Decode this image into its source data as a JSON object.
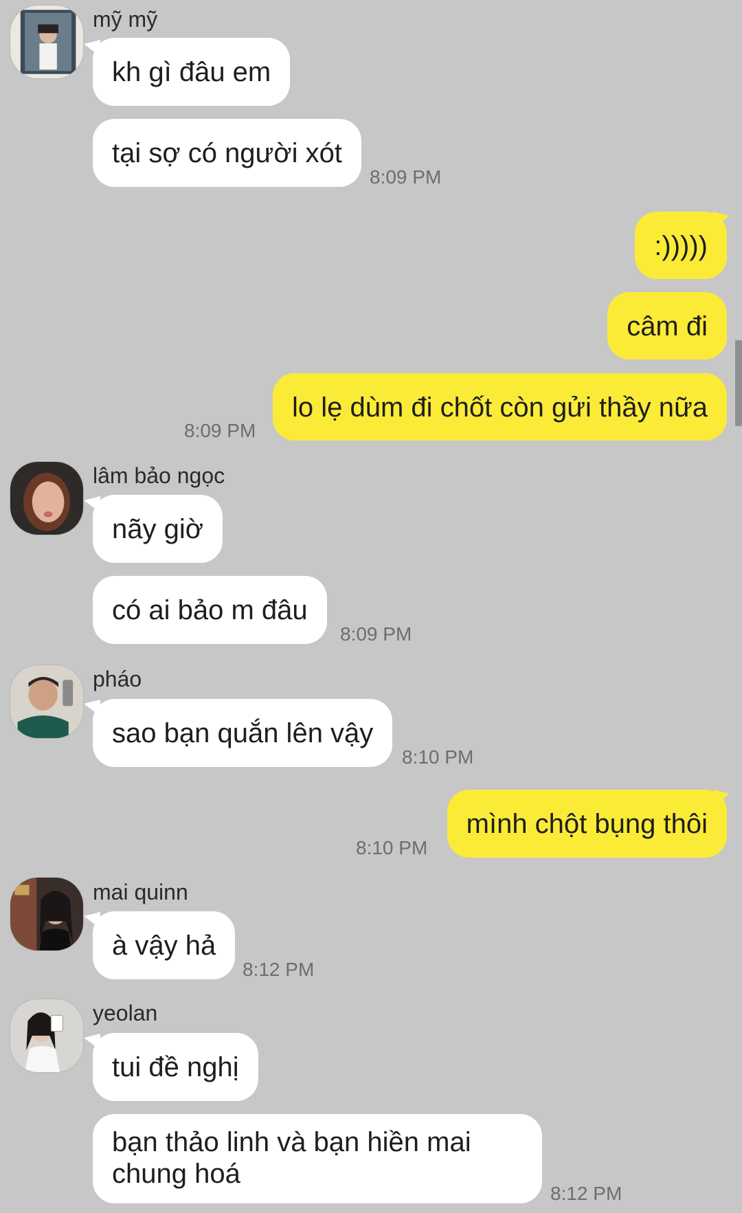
{
  "messages": [
    {
      "sender": "mỹ mỹ",
      "avatar": "avatar-my-my",
      "lines": [
        "kh gì đâu em",
        "tại sợ có người xót"
      ],
      "time": "8:09 PM"
    },
    {
      "outgoing": true,
      "lines": [
        ":)))))",
        "câm đi",
        "lo lẹ dùm đi chốt còn gửi thầy nữa"
      ],
      "time": "8:09 PM"
    },
    {
      "sender": "lâm bảo ngọc",
      "avatar": "avatar-lam-bao-ngoc",
      "lines": [
        "nãy giờ",
        "có ai bảo m đâu"
      ],
      "time": "8:09 PM"
    },
    {
      "sender": "pháo",
      "avatar": "avatar-phao",
      "lines": [
        "sao bạn quắn lên vậy"
      ],
      "time": "8:10 PM"
    },
    {
      "outgoing": true,
      "lines": [
        "mình chột bụng thôi"
      ],
      "time": "8:10 PM"
    },
    {
      "sender": "mai quinn",
      "avatar": "avatar-mai-quinn",
      "lines": [
        "à vậy hả"
      ],
      "time": "8:12 PM"
    },
    {
      "sender": "yeolan",
      "avatar": "avatar-yeolan",
      "lines": [
        "tui đề nghị",
        "bạn thảo linh và bạn hiền mai chung hoá"
      ],
      "time": "8:12 PM"
    }
  ],
  "colors": {
    "background": "#c7c7c7",
    "incoming_bubble": "#ffffff",
    "outgoing_bubble": "#fbeb37",
    "timestamp": "#6d6d6d"
  }
}
